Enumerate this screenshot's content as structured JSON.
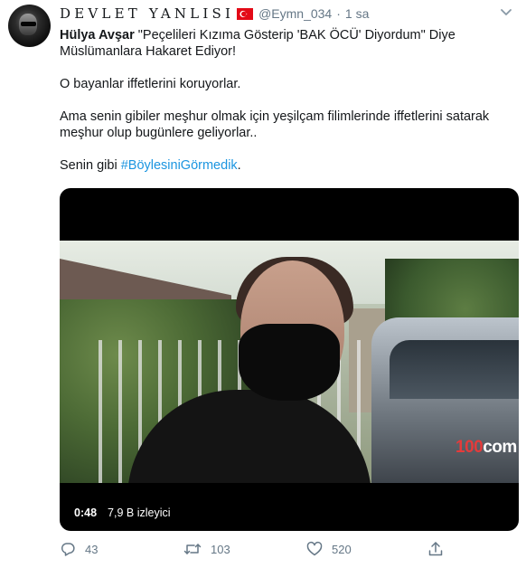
{
  "tweet": {
    "display_name": "DEVLET YANLISI",
    "handle": "@Eymn_034",
    "separator": "·",
    "time": "1 sa",
    "body": {
      "line1_bold": "Hülya Avşar",
      "line1_rest": " \"Peçelileri Kızıma Gösterip 'BAK ÖCÜ' Diyordum\" Diye Müslümanlara Hakaret Ediyor!",
      "para2": "O bayanlar iffetlerini koruyorlar.",
      "para3": "Ama senin gibiler meşhur olmak için yeşilçam filimlerinde iffetlerini satarak meşhur olup bugünlere geliyorlar..",
      "para4_text": "Senin gibi ",
      "para4_hashtag": "#BöylesiniGörmedik",
      "para4_end": "."
    },
    "video": {
      "duration": "0:48",
      "views": "7,9 B izleyici",
      "logo_digits": "100",
      "logo_letters": "com"
    },
    "actions": {
      "replies": "43",
      "retweets": "103",
      "likes": "520"
    }
  },
  "colors": {
    "hashtag": "#1b95e0",
    "meta_gray": "#657786",
    "flag_red": "#e30a17"
  },
  "icons": [
    "reply-icon",
    "retweet-icon",
    "like-icon",
    "share-icon",
    "chevron-down-icon",
    "turkey-flag-icon"
  ]
}
